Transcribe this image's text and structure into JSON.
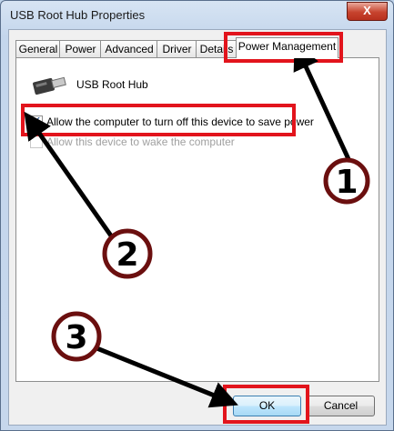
{
  "window": {
    "title": "USB Root Hub Properties",
    "close_label": "X"
  },
  "tabs": [
    "General",
    "Power",
    "Advanced",
    "Driver",
    "Details",
    "Power Management"
  ],
  "device": {
    "name": "USB Root Hub"
  },
  "options": {
    "allow_off": "Allow the computer to turn off this device to save power",
    "allow_wake": "Allow this device to wake the computer"
  },
  "buttons": {
    "ok": "OK",
    "cancel": "Cancel"
  },
  "annotations": {
    "step1": "1",
    "step2": "2",
    "step3": "3",
    "color": "#e2141c"
  }
}
